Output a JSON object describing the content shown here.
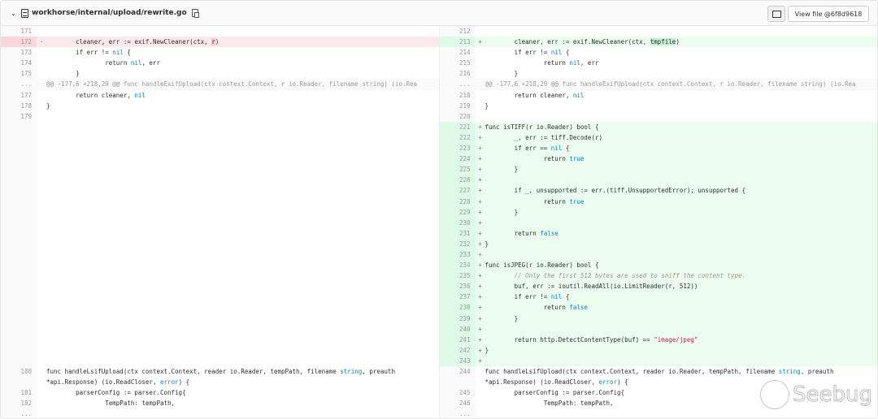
{
  "header": {
    "file_path": "workhorse/internal/upload/rewrite.go",
    "view_file_label": "View file @6f8d9618"
  },
  "watermark": "Seebug",
  "rows": [
    {
      "l": {
        "n": "171",
        "t": "ctx",
        "c": ""
      },
      "r": {
        "n": "212",
        "t": "ctx",
        "c": ""
      }
    },
    {
      "l": {
        "n": "172",
        "t": "del",
        "s": "-",
        "c": "\tcleaner, err := exif.NewCleaner(ctx, r)",
        "hl": "r"
      },
      "r": {
        "n": "213",
        "t": "add",
        "s": "+",
        "c": "\tcleaner, err := exif.NewCleaner(ctx, tmpfile)",
        "hl": "tmpfile"
      }
    },
    {
      "l": {
        "n": "173",
        "t": "ctx",
        "c": "\tif err != nil {"
      },
      "r": {
        "n": "214",
        "t": "ctx",
        "c": "\tif err != nil {"
      }
    },
    {
      "l": {
        "n": "174",
        "t": "ctx",
        "c": "\t\treturn nil, err"
      },
      "r": {
        "n": "215",
        "t": "ctx",
        "c": "\t\treturn nil, err"
      }
    },
    {
      "l": {
        "n": "175",
        "t": "ctx",
        "c": "\t}"
      },
      "r": {
        "n": "216",
        "t": "ctx",
        "c": "\t}"
      }
    },
    {
      "l": {
        "n": "...",
        "t": "hunk",
        "c": "@@ -177,6 +218,29 @@ func handleExifUpload(ctx context.Context, r io.Reader, filename string) (io.Rea"
      },
      "r": {
        "n": "...",
        "t": "hunk",
        "c": "@@ -177,6 +218,29 @@ func handleExifUpload(ctx context.Context, r io.Reader, filename string) (io.Rea"
      }
    },
    {
      "l": {
        "n": "177",
        "t": "ctx",
        "c": "\treturn cleaner, nil"
      },
      "r": {
        "n": "218",
        "t": "ctx",
        "c": "\treturn cleaner, nil"
      }
    },
    {
      "l": {
        "n": "178",
        "t": "ctx",
        "c": "}"
      },
      "r": {
        "n": "219",
        "t": "ctx",
        "c": "}"
      }
    },
    {
      "l": {
        "n": "179",
        "t": "ctx",
        "c": ""
      },
      "r": {
        "n": "220",
        "t": "ctx",
        "c": ""
      }
    },
    {
      "l": {
        "n": "",
        "t": "empty",
        "c": ""
      },
      "r": {
        "n": "221",
        "t": "add",
        "s": "+",
        "c": "func isTIFF(r io.Reader) bool {"
      }
    },
    {
      "l": {
        "n": "",
        "t": "empty",
        "c": ""
      },
      "r": {
        "n": "222",
        "t": "add",
        "s": "+",
        "c": "\t_, err := tiff.Decode(r)"
      }
    },
    {
      "l": {
        "n": "",
        "t": "empty",
        "c": ""
      },
      "r": {
        "n": "223",
        "t": "add",
        "s": "+",
        "c": "\tif err == nil {"
      }
    },
    {
      "l": {
        "n": "",
        "t": "empty",
        "c": ""
      },
      "r": {
        "n": "224",
        "t": "add",
        "s": "+",
        "c": "\t\treturn true"
      }
    },
    {
      "l": {
        "n": "",
        "t": "empty",
        "c": ""
      },
      "r": {
        "n": "225",
        "t": "add",
        "s": "+",
        "c": "\t}"
      }
    },
    {
      "l": {
        "n": "",
        "t": "empty",
        "c": ""
      },
      "r": {
        "n": "226",
        "t": "add",
        "s": "+",
        "c": ""
      }
    },
    {
      "l": {
        "n": "",
        "t": "empty",
        "c": ""
      },
      "r": {
        "n": "227",
        "t": "add",
        "s": "+",
        "c": "\tif _, unsupported := err.(tiff.UnsupportedError); unsupported {"
      }
    },
    {
      "l": {
        "n": "",
        "t": "empty",
        "c": ""
      },
      "r": {
        "n": "228",
        "t": "add",
        "s": "+",
        "c": "\t\treturn true"
      }
    },
    {
      "l": {
        "n": "",
        "t": "empty",
        "c": ""
      },
      "r": {
        "n": "229",
        "t": "add",
        "s": "+",
        "c": "\t}"
      }
    },
    {
      "l": {
        "n": "",
        "t": "empty",
        "c": ""
      },
      "r": {
        "n": "230",
        "t": "add",
        "s": "+",
        "c": ""
      }
    },
    {
      "l": {
        "n": "",
        "t": "empty",
        "c": ""
      },
      "r": {
        "n": "231",
        "t": "add",
        "s": "+",
        "c": "\treturn false"
      }
    },
    {
      "l": {
        "n": "",
        "t": "empty",
        "c": ""
      },
      "r": {
        "n": "232",
        "t": "add",
        "s": "+",
        "c": "}"
      }
    },
    {
      "l": {
        "n": "",
        "t": "empty",
        "c": ""
      },
      "r": {
        "n": "233",
        "t": "add",
        "s": "+",
        "c": ""
      }
    },
    {
      "l": {
        "n": "",
        "t": "empty",
        "c": ""
      },
      "r": {
        "n": "234",
        "t": "add",
        "s": "+",
        "c": "func isJPEG(r io.Reader) bool {"
      }
    },
    {
      "l": {
        "n": "",
        "t": "empty",
        "c": ""
      },
      "r": {
        "n": "235",
        "t": "add",
        "s": "+",
        "c": "\t// Only the first 512 bytes are used to sniff the content type."
      }
    },
    {
      "l": {
        "n": "",
        "t": "empty",
        "c": ""
      },
      "r": {
        "n": "236",
        "t": "add",
        "s": "+",
        "c": "\tbuf, err := ioutil.ReadAll(io.LimitReader(r, 512))"
      }
    },
    {
      "l": {
        "n": "",
        "t": "empty",
        "c": ""
      },
      "r": {
        "n": "237",
        "t": "add",
        "s": "+",
        "c": "\tif err != nil {"
      }
    },
    {
      "l": {
        "n": "",
        "t": "empty",
        "c": ""
      },
      "r": {
        "n": "238",
        "t": "add",
        "s": "+",
        "c": "\t\treturn false"
      }
    },
    {
      "l": {
        "n": "",
        "t": "empty",
        "c": ""
      },
      "r": {
        "n": "239",
        "t": "add",
        "s": "+",
        "c": "\t}"
      }
    },
    {
      "l": {
        "n": "",
        "t": "empty",
        "c": ""
      },
      "r": {
        "n": "240",
        "t": "add",
        "s": "+",
        "c": ""
      }
    },
    {
      "l": {
        "n": "",
        "t": "empty",
        "c": ""
      },
      "r": {
        "n": "241",
        "t": "add",
        "s": "+",
        "c": "\treturn http.DetectContentType(buf) == \"image/jpeg\""
      }
    },
    {
      "l": {
        "n": "",
        "t": "empty",
        "c": ""
      },
      "r": {
        "n": "242",
        "t": "add",
        "s": "+",
        "c": "}"
      }
    },
    {
      "l": {
        "n": "",
        "t": "empty",
        "c": ""
      },
      "r": {
        "n": "243",
        "t": "add",
        "s": "+",
        "c": ""
      }
    },
    {
      "l": {
        "n": "180",
        "t": "ctx",
        "c": "func handleLsifUpload(ctx context.Context, reader io.Reader, tempPath, filename string, preauth *api.Response) (io.ReadCloser, error) {"
      },
      "r": {
        "n": "244",
        "t": "ctx",
        "c": "func handleLsifUpload(ctx context.Context, reader io.Reader, tempPath, filename string, preauth *api.Response) (io.ReadCloser, error) {"
      }
    },
    {
      "l": {
        "n": "181",
        "t": "ctx",
        "c": "\tparserConfig := parser.Config{"
      },
      "r": {
        "n": "245",
        "t": "ctx",
        "c": "\tparserConfig := parser.Config{"
      }
    },
    {
      "l": {
        "n": "182",
        "t": "ctx",
        "c": "\t\tTempPath: tempPath,"
      },
      "r": {
        "n": "246",
        "t": "ctx",
        "c": "\t\tTempPath: tempPath,"
      }
    },
    {
      "l": {
        "n": "...",
        "t": "ctx",
        "c": ""
      },
      "r": {
        "n": "...",
        "t": "ctx",
        "c": ""
      }
    }
  ]
}
